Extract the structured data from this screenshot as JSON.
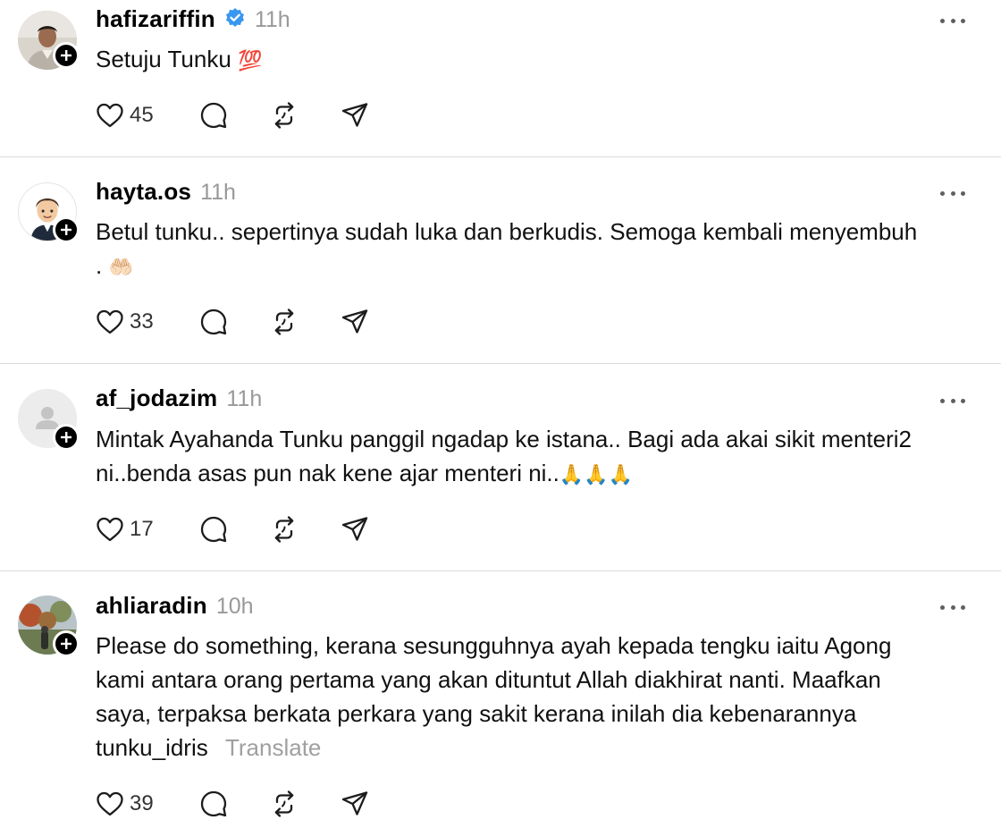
{
  "posts": [
    {
      "username": "hafizariffin",
      "verified": true,
      "time": "11h",
      "text": "Setuju Tunku",
      "emoji": "💯",
      "likes": "45"
    },
    {
      "username": "hayta.os",
      "verified": false,
      "time": "11h",
      "text_line1": "Betul tunku.. sepertinya sudah luka dan berkudis. Semoga kembali menyembuh",
      "text_line2": ".",
      "emoji": "🤲🏻",
      "likes": "33"
    },
    {
      "username": "af_jodazim",
      "verified": false,
      "time": "11h",
      "text_line1": "Mintak Ayahanda Tunku panggil ngadap ke istana.. Bagi ada akai sikit menteri2",
      "text_line2": "ni..benda asas pun nak kene ajar menteri ni..",
      "emoji": "🙏🙏🙏",
      "likes": "17"
    },
    {
      "username": "ahliaradin",
      "verified": false,
      "time": "10h",
      "text_line1": "Please do something, kerana sesungguhnya ayah kepada tengku iaitu Agong",
      "text_line2": "kami antara orang pertama yang akan dituntut Allah diakhirat nanti. Maafkan",
      "text_line3": "saya, terpaksa berkata perkara yang sakit kerana inilah dia kebenarannya",
      "text_line4": "tunku_idris",
      "translate": "Translate",
      "likes": "39"
    }
  ],
  "icons": {
    "like": "heart-icon",
    "reply": "comment-icon",
    "repost": "repost-icon",
    "share": "send-icon",
    "more": "more-icon",
    "verified": "verified-badge-icon",
    "follow": "plus-icon"
  },
  "colors": {
    "verified": "#3897f0",
    "muted": "#999999",
    "divider": "#dbdbdb"
  }
}
